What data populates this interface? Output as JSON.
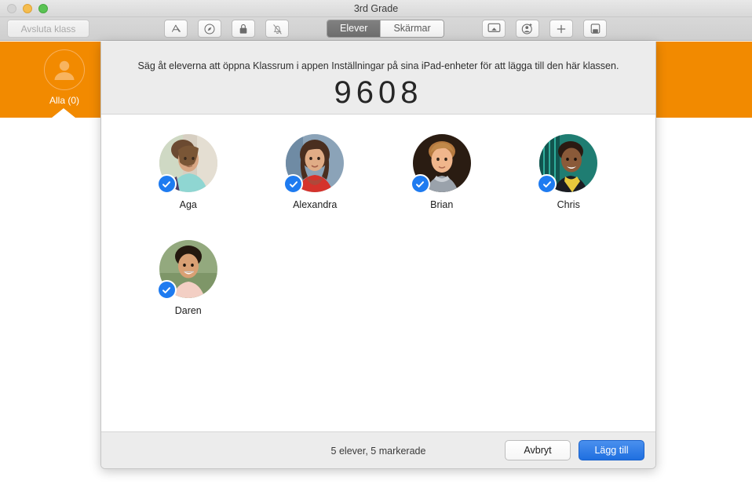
{
  "window": {
    "title": "3rd Grade",
    "traffic_lights": [
      "close-button",
      "minimize-button",
      "zoom-button"
    ]
  },
  "toolbar": {
    "end_class_label": "Avsluta klass",
    "left_icons": [
      {
        "name": "app-store-icon",
        "label": "App Store"
      },
      {
        "name": "safari-compass-icon",
        "label": "Navigera"
      },
      {
        "name": "lock-icon",
        "label": "Lås"
      },
      {
        "name": "bell-slash-icon",
        "label": "Tysta"
      }
    ],
    "segmented": {
      "options": [
        "Elever",
        "Skärmar"
      ],
      "selected": "Elever"
    },
    "right_icons": [
      {
        "name": "airplay-screen-icon",
        "label": "AirPlay"
      },
      {
        "name": "person-add-icon",
        "label": "Lägg till elev"
      },
      {
        "name": "plus-icon",
        "label": "Lägg till"
      },
      {
        "name": "device-icon",
        "label": "Enhet"
      }
    ]
  },
  "classbar": {
    "accent_color": "#f28a00",
    "all_group": {
      "icon": "person-circle-icon",
      "label": "Alla (0)"
    }
  },
  "sheet": {
    "instruction": "Säg åt eleverna att öppna Klassrum i appen Inställningar på sina iPad-enheter för att lägga till den här klassen.",
    "code": "9608",
    "students": [
      {
        "name": "Aga",
        "selected": true
      },
      {
        "name": "Alexandra",
        "selected": true
      },
      {
        "name": "Brian",
        "selected": true
      },
      {
        "name": "Chris",
        "selected": true
      },
      {
        "name": "Daren",
        "selected": true
      }
    ],
    "footer": {
      "count_label": "5 elever, 5 markerade",
      "cancel_label": "Avbryt",
      "add_label": "Lägg till"
    },
    "check_badge_color": "#1e7bf0",
    "primary_button_color": "#1f6fe0"
  }
}
